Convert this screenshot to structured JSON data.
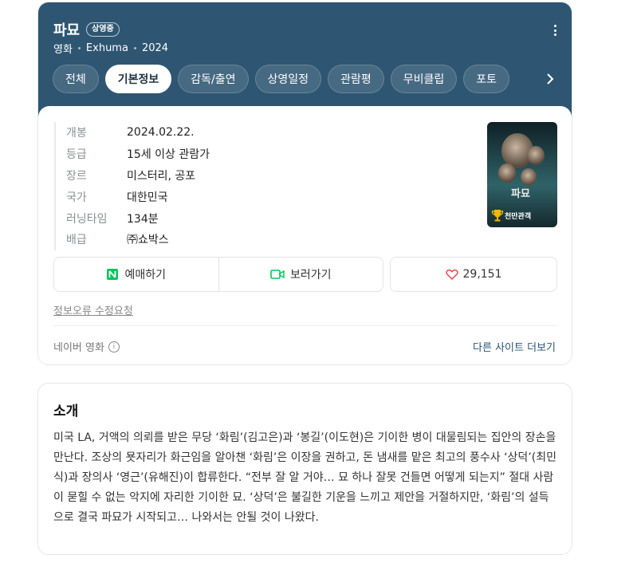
{
  "header": {
    "title": "파묘",
    "status_badge": "상영중",
    "meta": [
      "영화",
      "Exhuma",
      "2024"
    ],
    "more_icon": "more-vertical-icon"
  },
  "tabs": [
    {
      "label": "전체",
      "active": false
    },
    {
      "label": "기본정보",
      "active": true
    },
    {
      "label": "감독/출연",
      "active": false
    },
    {
      "label": "상영일정",
      "active": false
    },
    {
      "label": "관람평",
      "active": false
    },
    {
      "label": "무비클립",
      "active": false
    },
    {
      "label": "포토",
      "active": false
    }
  ],
  "info": [
    {
      "key": "개봉",
      "value": "2024.02.22."
    },
    {
      "key": "등급",
      "value": "15세 이상 관람가"
    },
    {
      "key": "장르",
      "value": "미스터리, 공포"
    },
    {
      "key": "국가",
      "value": "대한민국"
    },
    {
      "key": "러닝타임",
      "value": "134분"
    },
    {
      "key": "배급",
      "value": "㈜쇼박스"
    }
  ],
  "poster": {
    "title_text": "파묘",
    "award_label": "천만관객"
  },
  "actions": {
    "book_label": "예매하기",
    "watch_label": "보러가기",
    "like_count": "29,151"
  },
  "footer": {
    "report_label": "정보오류 수정요청",
    "source_label": "네이버 영화",
    "other_sites_label": "다른 사이트 더보기"
  },
  "intro": {
    "title": "소개",
    "text": "미국 LA, 거액의 의뢰를 받은 무당 ‘화림’(김고은)과 ‘봉길’(이도현)은 기이한 병이 대물림되는 집안의 장손을 만난다. 조상의 묫자리가 화근임을 알아챈 ‘화림’은 이장을 권하고, 돈 냄새를 맡은 최고의 풍수사 ‘상덕’(최민식)과 장의사 ‘영근’(유해진)이 합류한다. “전부 잘 알 거야… 묘 하나 잘못 건들면 어떻게 되는지” 절대 사람이 묻힐 수 없는 악지에 자리한 기이한 묘. ‘상덕’은 불길한 기운을 느끼고 제안을 거절하지만, ‘화림’의 설득으로 결국 파묘가 시작되고… 나와서는 안될 것이 나왔다."
  },
  "colors": {
    "header_bg": "#2e5672",
    "link": "#2a5374",
    "naver_green": "#03c75a",
    "heart_red": "#e8464b",
    "trophy_gold": "#f2b705"
  }
}
